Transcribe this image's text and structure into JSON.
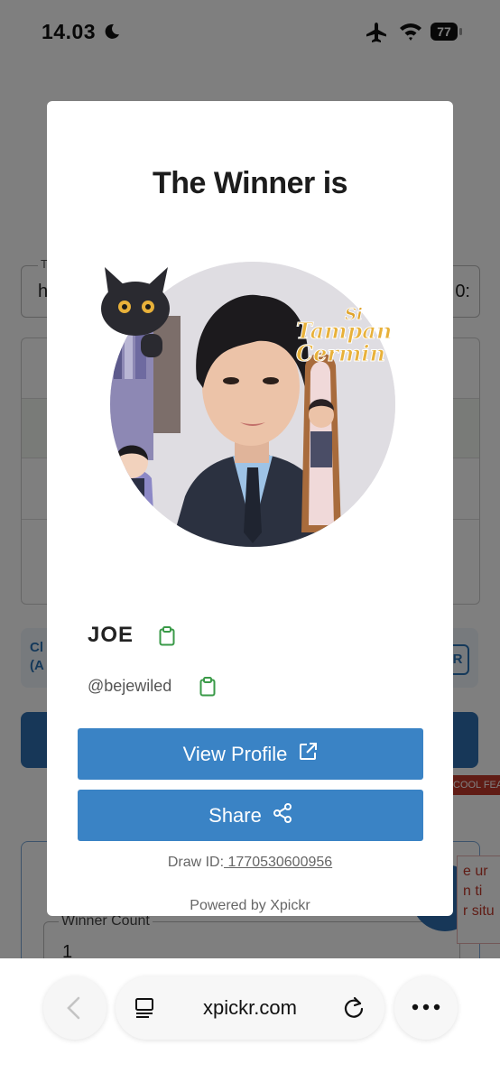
{
  "status_bar": {
    "time": "14.03",
    "battery": "77"
  },
  "background_page": {
    "input_value_left": "h",
    "input_value_right": "0:",
    "chip_left_line1": "Cl",
    "chip_left_line2": "(A",
    "chip_right": "R",
    "ribbon": "COOL FEA",
    "field_label": "Winner Count",
    "field_value": "1",
    "tip_lines": [
      "e ur",
      "n ti",
      "r situ"
    ]
  },
  "modal": {
    "title": "The Winner is",
    "winner_name": "JOE",
    "winner_handle": "@bejewiled",
    "photo_text_line1": "Si",
    "photo_text_line2": "Tampan",
    "photo_text_line3": "Cermin",
    "view_profile_label": "View Profile",
    "share_label": "Share",
    "draw_id_label": "Draw ID:",
    "draw_id_value": " 1770530600956",
    "powered_by": "Powered by Xpickr"
  },
  "browser": {
    "url": "xpickr.com"
  },
  "icons": {
    "copy": "clipboard-icon",
    "external": "external-link-icon",
    "share": "share-icon",
    "back": "chevron-left-icon",
    "reader": "reader-icon",
    "reload": "reload-icon",
    "more": "more-icon"
  },
  "colors": {
    "accent": "#3a83c5",
    "copy_icon": "#3a9a48",
    "overlay": "rgba(0,0,0,0.5)"
  }
}
